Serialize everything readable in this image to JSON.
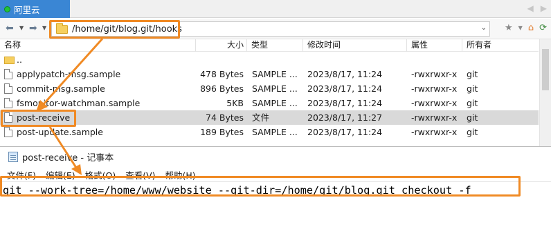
{
  "tab": {
    "label": "阿里云"
  },
  "address": {
    "path": "/home/git/blog.git/hooks"
  },
  "columns": {
    "name": "名称",
    "size": "大小",
    "type": "类型",
    "modified": "修改时间",
    "attrs": "属性",
    "owner": "所有者"
  },
  "files": [
    {
      "name": "..",
      "size": "",
      "type": "",
      "modified": "",
      "attrs": "",
      "owner": "",
      "icon": "folder-icon"
    },
    {
      "name": "applypatch-msg.sample",
      "size": "478 Bytes",
      "type": "SAMPLE ...",
      "modified": "2023/8/17, 11:24",
      "attrs": "-rwxrwxr-x",
      "owner": "git",
      "icon": "file-icon"
    },
    {
      "name": "commit-msg.sample",
      "size": "896 Bytes",
      "type": "SAMPLE ...",
      "modified": "2023/8/17, 11:24",
      "attrs": "-rwxrwxr-x",
      "owner": "git",
      "icon": "file-icon"
    },
    {
      "name": "fsmonitor-watchman.sample",
      "size": "5KB",
      "type": "SAMPLE ...",
      "modified": "2023/8/17, 11:24",
      "attrs": "-rwxrwxr-x",
      "owner": "git",
      "icon": "file-icon"
    },
    {
      "name": "post-receive",
      "size": "74 Bytes",
      "type": "文件",
      "modified": "2023/8/17, 11:27",
      "attrs": "-rwxrwxr-x",
      "owner": "git",
      "icon": "file-icon",
      "selected": true
    },
    {
      "name": "post-update.sample",
      "size": "189 Bytes",
      "type": "SAMPLE ...",
      "modified": "2023/8/17, 11:24",
      "attrs": "-rwxrwxr-x",
      "owner": "git",
      "icon": "file-icon"
    }
  ],
  "notepad": {
    "title": "post-receive - 记事本",
    "menu": [
      "文件(F)",
      "编辑(E)",
      "格式(O)",
      "查看(V)",
      "帮助(H)"
    ],
    "content": "git --work-tree=/home/www/website --git-dir=/home/git/blog.git checkout -f"
  },
  "colors": {
    "highlight": "#f08a24",
    "tab": "#3a86d4",
    "selected_row": "#d9d9d9"
  }
}
